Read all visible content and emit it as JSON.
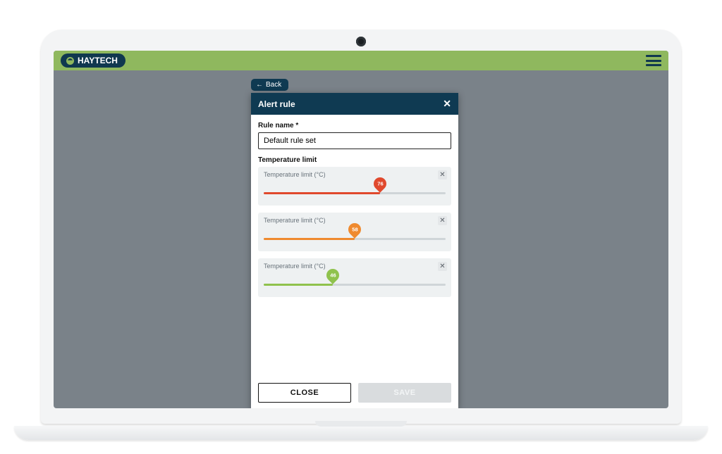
{
  "brand": {
    "name": "HAYTECH"
  },
  "nav": {
    "back_label": "Back"
  },
  "modal": {
    "title": "Alert rule",
    "rule_name_label": "Rule name *",
    "rule_name_value": "Default rule set",
    "section_label": "Temperature limit",
    "sliders": [
      {
        "caption": "Temperature limit (°C)",
        "value": 76,
        "percent": 64,
        "color": "#e0492d"
      },
      {
        "caption": "Temperature limit (°C)",
        "value": 58,
        "percent": 50,
        "color": "#ef8a2f"
      },
      {
        "caption": "Temperature limit (°C)",
        "value": 46,
        "percent": 38,
        "color": "#8fc24d"
      }
    ],
    "close_button": "CLOSE",
    "save_button": "SAVE"
  }
}
